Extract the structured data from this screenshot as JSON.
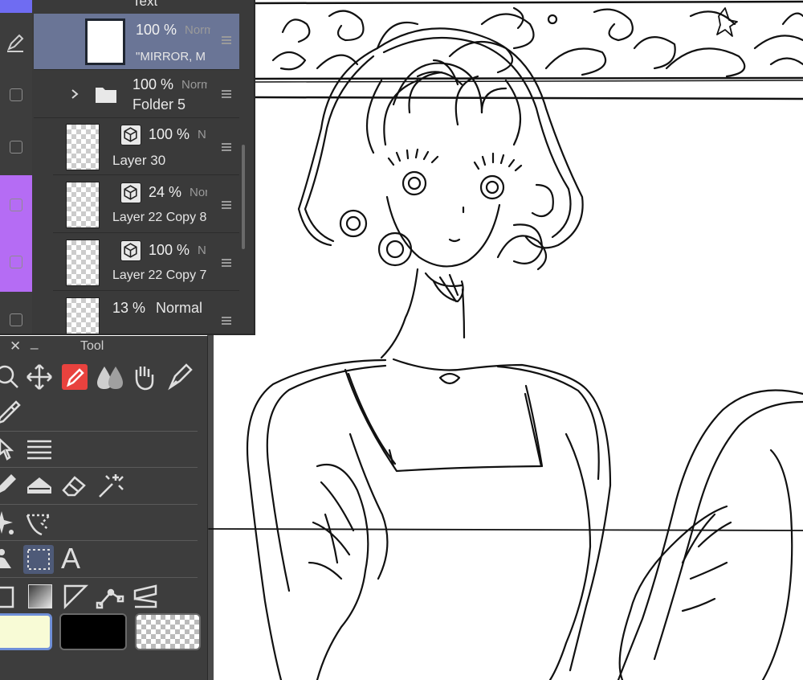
{
  "layers_panel": {
    "top_cut_label": "Text",
    "layers": [
      {
        "opacity": "100 %",
        "blend": "Norm",
        "name": "\"MIRROR, MIR",
        "selected": true
      },
      {
        "opacity": "100 %",
        "blend": "Norm",
        "name": "Folder 5",
        "type": "folder"
      },
      {
        "opacity": "100 %",
        "blend": "N",
        "name": "Layer 30",
        "type": "3d"
      },
      {
        "opacity": "24 %",
        "blend": "Nor",
        "name": "Layer 22 Copy 8",
        "type": "3d"
      },
      {
        "opacity": "100 %",
        "blend": "N",
        "name": "Layer 22 Copy 7",
        "type": "3d"
      },
      {
        "opacity": "13 %",
        "blend": "Normal",
        "name": ""
      }
    ],
    "color_strips": [
      "#6f6cf2",
      "#b56cf4"
    ]
  },
  "tool_panel": {
    "title": "Tool",
    "close_glyph": "✕",
    "minimize_glyph": "_",
    "text_tool_glyph": "A",
    "colors": {
      "main": "#f8fbd6",
      "sub": "#000000"
    }
  }
}
